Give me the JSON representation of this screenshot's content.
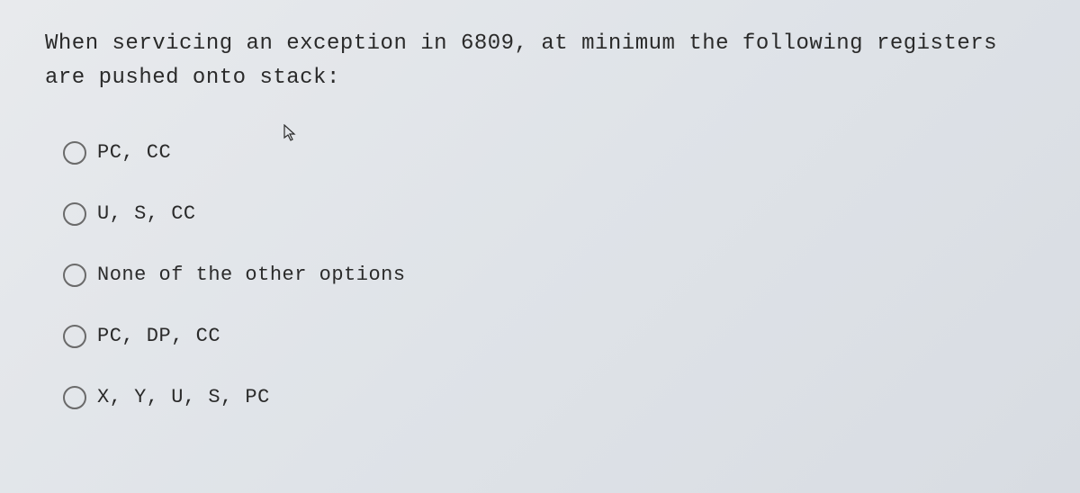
{
  "question": "When servicing an exception in 6809, at minimum the following registers are pushed onto stack:",
  "options": [
    {
      "label": "PC, CC"
    },
    {
      "label": "U, S, CC"
    },
    {
      "label": "None of the other options"
    },
    {
      "label": "PC, DP, CC"
    },
    {
      "label": "X, Y, U, S, PC"
    }
  ]
}
